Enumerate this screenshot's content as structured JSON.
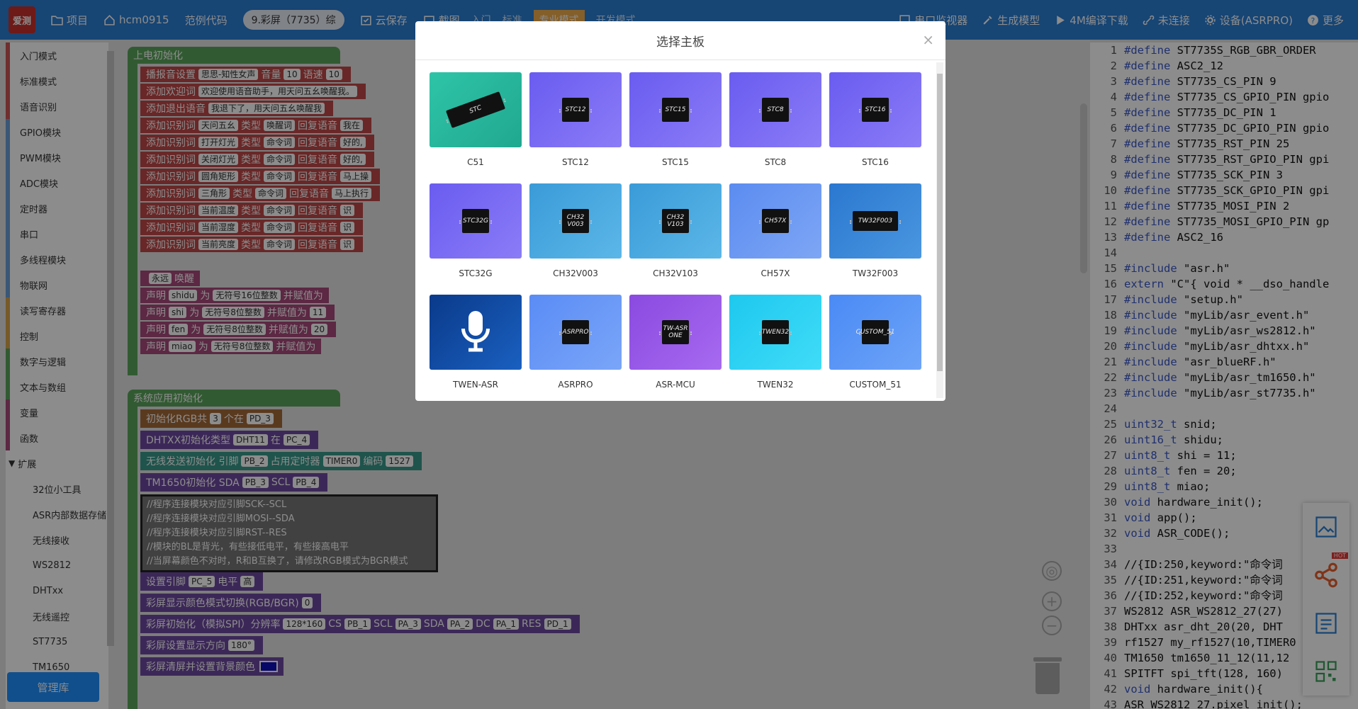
{
  "topbar": {
    "logo_text": "爱测",
    "items_left": [
      {
        "icon": "folder-icon",
        "label": "项目"
      },
      {
        "icon": "home-icon",
        "label": "hcm0915"
      },
      {
        "icon": "",
        "label": "范例代码"
      }
    ],
    "board_pill": "9.彩屏（7735）综",
    "items_mid": [
      {
        "icon": "cloud-save-icon",
        "label": "云保存"
      },
      {
        "icon": "screenshot-icon",
        "label": "截图"
      }
    ],
    "mode_tabs": [
      "入门",
      "标准",
      "专业模式",
      "开发模式"
    ],
    "items_right": [
      {
        "icon": "monitor-icon",
        "label": "串口监视器"
      },
      {
        "icon": "wrench-icon",
        "label": "生成模型"
      },
      {
        "icon": "play-icon",
        "label": "4M编译下载"
      },
      {
        "icon": "link-icon",
        "label": "未连接"
      },
      {
        "icon": "gear-icon",
        "label": "设备(ASRPRO)"
      },
      {
        "icon": "help-icon",
        "label": "更多"
      }
    ]
  },
  "sidebar": {
    "categories": [
      "入门模式",
      "标准模式",
      "语音识别",
      "GPIO模块",
      "PWM模块",
      "ADC模块",
      "定时器",
      "串口",
      "多线程模块",
      "物联网",
      "读写寄存器",
      "控制",
      "数字与逻辑",
      "文本与数组",
      "变量",
      "函数"
    ],
    "expand_label": "扩展",
    "subcategories": [
      "32位小工具",
      "ASR内部数据存储",
      "无线接收",
      "WS2812",
      "DHTxx",
      "无线遥控",
      "ST7735",
      "TM1650"
    ],
    "manage_label": "管理库"
  },
  "blocks": {
    "power_on_hat": "上电初始化",
    "b1": {
      "a": "播报音设置",
      "b": "思思-知性女声",
      "c": "音量",
      "d": "10",
      "e": "语速",
      "f": "10"
    },
    "b2": {
      "a": "添加欢迎词",
      "b": "欢迎使用语音助手，用天问五幺唤醒我。"
    },
    "b3": {
      "a": "添加退出语音",
      "b": "我退下了，用天问五幺唤醒我"
    },
    "cmd_rows": [
      {
        "a": "添加识别词",
        "b": "天问五幺",
        "c": "类型",
        "d": "唤醒词",
        "e": "回复语音",
        "f": "我在"
      },
      {
        "a": "添加识别词",
        "b": "打开灯光",
        "c": "类型",
        "d": "命令词",
        "e": "回复语音",
        "f": "好的,"
      },
      {
        "a": "添加识别词",
        "b": "关闭灯光",
        "c": "类型",
        "d": "命令词",
        "e": "回复语音",
        "f": "好的,"
      },
      {
        "a": "添加识别词",
        "b": "圆角矩形",
        "c": "类型",
        "d": "命令词",
        "e": "回复语音",
        "f": "马上操"
      },
      {
        "a": "添加识别词",
        "b": "三角形",
        "c": "类型",
        "d": "命令词",
        "e": "回复语音",
        "f": "马上执行"
      },
      {
        "a": "添加识别词",
        "b": "当前温度",
        "c": "类型",
        "d": "命令词",
        "e": "回复语音",
        "f": "识"
      },
      {
        "a": "添加识别词",
        "b": "当前湿度",
        "c": "类型",
        "d": "命令词",
        "e": "回复语音",
        "f": "识"
      },
      {
        "a": "添加识别词",
        "b": "当前亮度",
        "c": "类型",
        "d": "命令词",
        "e": "回复语音",
        "f": "识"
      }
    ],
    "wake": {
      "a": "永远",
      "b": "唤醒"
    },
    "decl_rows": [
      {
        "a": "声明",
        "b": "shidu",
        "c": "为",
        "d": "无符号16位整数",
        "e": "并赋值为",
        "f": ""
      },
      {
        "a": "声明",
        "b": "shi",
        "c": "为",
        "d": "无符号8位整数",
        "e": "并赋值为",
        "f": "11"
      },
      {
        "a": "声明",
        "b": "fen",
        "c": "为",
        "d": "无符号8位整数",
        "e": "并赋值为",
        "f": "20"
      },
      {
        "a": "声明",
        "b": "miao",
        "c": "为",
        "d": "无符号8位整数",
        "e": "并赋值为",
        "f": ""
      }
    ],
    "sys_hat": "系统应用初始化",
    "rgb": {
      "a": "初始化RGB共",
      "b": "3",
      "c": "个在",
      "d": "PD_3"
    },
    "dht": {
      "a": "DHTXX初始化类型",
      "b": "DHT11",
      "c": "在",
      "d": "PC_4"
    },
    "wireless": {
      "a": "无线发送初始化 引脚",
      "b": "PB_2",
      "c": "占用定时器",
      "d": "TIMER0",
      "e": "编码",
      "f": "1527"
    },
    "tm1650": {
      "a": "TM1650初始化 SDA",
      "b": "PB_3",
      "c": "SCL",
      "d": "PB_4"
    },
    "comment_lines": [
      "//程序连接模块对应引脚SCK--SCL",
      "//程序连接模块对应引脚MOSI--SDA",
      "//程序连接模块对应引脚RST--RES",
      "//模块的BL是背光，有些接低电平，有些接高电平",
      "//当屏幕颜色不对时，R和B互换了，请修改RGB模式为BGR模式"
    ],
    "setpin": {
      "a": "设置引脚",
      "b": "PC_5",
      "c": "电平",
      "d": "高"
    },
    "colormode": {
      "a": "彩屏显示颜色模式切换(RGB/BGR)",
      "b": "0"
    },
    "screen_init": {
      "a": "彩屏初始化（模拟SPI）",
      "b": "分辨率",
      "c": "128*160",
      "d": "CS",
      "e": "PB_1",
      "f": "SCL",
      "g": "PA_3",
      "h": "SDA",
      "i": "PA_2",
      "j": "DC",
      "k": "PA_1",
      "l": "RES",
      "m": "PD_1"
    },
    "rotation": {
      "a": "彩屏设置显示方向",
      "b": "180°"
    },
    "clear": {
      "a": "彩屏清屏并设置背景颜色"
    }
  },
  "code_lines": [
    {
      "n": "1",
      "t": "#define ST7735S_RGB_GBR_ORDER"
    },
    {
      "n": "2",
      "t": "#define ASC2_12"
    },
    {
      "n": "3",
      "t": "#define ST7735_CS_PIN 9"
    },
    {
      "n": "4",
      "t": "#define ST7735_CS_GPIO_PIN gpio"
    },
    {
      "n": "5",
      "t": "#define ST7735_DC_PIN 1"
    },
    {
      "n": "6",
      "t": "#define ST7735_DC_GPIO_PIN gpio"
    },
    {
      "n": "7",
      "t": "#define ST7735_RST_PIN 25"
    },
    {
      "n": "8",
      "t": "#define ST7735_RST_GPIO_PIN gpi"
    },
    {
      "n": "9",
      "t": "#define ST7735_SCK_PIN 3"
    },
    {
      "n": "10",
      "t": "#define ST7735_SCK_GPIO_PIN gpi"
    },
    {
      "n": "11",
      "t": "#define ST7735_MOSI_PIN 2"
    },
    {
      "n": "12",
      "t": "#define ST7735_MOSI_GPIO_PIN gp"
    },
    {
      "n": "13",
      "t": "#define ASC2_16"
    },
    {
      "n": "14",
      "t": ""
    },
    {
      "n": "15",
      "t": "#include \"asr.h\""
    },
    {
      "n": "16",
      "t": "extern \"C\"{ void * __dso_handle"
    },
    {
      "n": "17",
      "t": "#include \"setup.h\""
    },
    {
      "n": "18",
      "t": "#include \"myLib/asr_event.h\""
    },
    {
      "n": "19",
      "t": "#include \"myLib/asr_ws2812.h\""
    },
    {
      "n": "20",
      "t": "#include \"myLib/asr_dhtxx.h\""
    },
    {
      "n": "21",
      "t": "#include \"asr_blueRF.h\""
    },
    {
      "n": "22",
      "t": "#include \"myLib/asr_tm1650.h\""
    },
    {
      "n": "23",
      "t": "#include \"myLib/asr_st7735.h\""
    },
    {
      "n": "24",
      "t": ""
    },
    {
      "n": "25",
      "t": "uint32_t snid;"
    },
    {
      "n": "26",
      "t": "uint16_t shidu;"
    },
    {
      "n": "27",
      "t": "uint8_t shi = 11;"
    },
    {
      "n": "28",
      "t": "uint8_t fen = 20;"
    },
    {
      "n": "29",
      "t": "uint8_t miao;"
    },
    {
      "n": "30",
      "t": "void hardware_init();"
    },
    {
      "n": "31",
      "t": "void app();"
    },
    {
      "n": "32",
      "t": "void ASR_CODE();"
    },
    {
      "n": "33",
      "t": ""
    },
    {
      "n": "34",
      "t": "//{ID:250,keyword:\"命令词"
    },
    {
      "n": "35",
      "t": "//{ID:251,keyword:\"命令词"
    },
    {
      "n": "36",
      "t": "//{ID:252,keyword:\"命令词"
    },
    {
      "n": "37",
      "t": "WS2812 ASR_WS2812_27(27)"
    },
    {
      "n": "38",
      "t": "DHTxx asr_dht_20(20, DHT"
    },
    {
      "n": "39",
      "t": "rf1527 my_rf1527(10,TIMER0"
    },
    {
      "n": "40",
      "t": "TM1650 tm1650_11_12(11,12"
    },
    {
      "n": "41",
      "t": "SPITFT spi_tft(128, 160)"
    },
    {
      "n": "42",
      "t": "void hardware_init(){"
    },
    {
      "n": "43",
      "t": "  ASR_WS2812_27.pixel_init();"
    }
  ],
  "float_bar": {
    "hot_badge": "HOT",
    "icons": [
      "image-icon",
      "share-icon",
      "edit-icon",
      "qrcode-icon"
    ]
  },
  "modal": {
    "title": "选择主板",
    "close": "×",
    "boards": [
      {
        "name": "C51",
        "chip": "STC",
        "bg": "#2ec4a8",
        "bg2": "#20a890"
      },
      {
        "name": "STC12",
        "chip": "STC12",
        "bg": "#6a5cf0",
        "bg2": "#8b7cf7"
      },
      {
        "name": "STC15",
        "chip": "STC15",
        "bg": "#6a5cf0",
        "bg2": "#8b7cf7"
      },
      {
        "name": "STC8",
        "chip": "STC8",
        "bg": "#6a5cf0",
        "bg2": "#8b7cf7"
      },
      {
        "name": "STC16",
        "chip": "STC16",
        "bg": "#6a5cf0",
        "bg2": "#8b7cf7"
      },
      {
        "name": "STC32G",
        "chip": "STC32G",
        "bg": "#6a5cf0",
        "bg2": "#8b7cf7"
      },
      {
        "name": "CH32V003",
        "chip": "CH32 V003",
        "bg": "#3a9bd8",
        "bg2": "#5cb7e8"
      },
      {
        "name": "CH32V103",
        "chip": "CH32 V103",
        "bg": "#3a9bd8",
        "bg2": "#5cb7e8"
      },
      {
        "name": "CH57X",
        "chip": "CH57X",
        "bg": "#5b8cf0",
        "bg2": "#7ea6f5"
      },
      {
        "name": "TW32F003",
        "chip": "TW32F003",
        "bg": "#2a78d0",
        "bg2": "#4a96e0"
      },
      {
        "name": "TWEN-ASR",
        "chip": "",
        "bg": "#0a3a8a",
        "bg2": "#1a60c0"
      },
      {
        "name": "ASRPRO",
        "chip": "ASRPRO",
        "bg": "#5a8cf5",
        "bg2": "#7aa5f8"
      },
      {
        "name": "ASR-MCU",
        "chip": "TW-ASR ONE",
        "bg": "#8a4ae0",
        "bg2": "#a76af0"
      },
      {
        "name": "TWEN32",
        "chip": "TWEN32",
        "bg": "#1ec8ee",
        "bg2": "#40dcf8"
      },
      {
        "name": "CUSTOM_51",
        "chip": "CUSTOM_51",
        "bg": "#4a8af5",
        "bg2": "#6ea4f8"
      }
    ]
  }
}
